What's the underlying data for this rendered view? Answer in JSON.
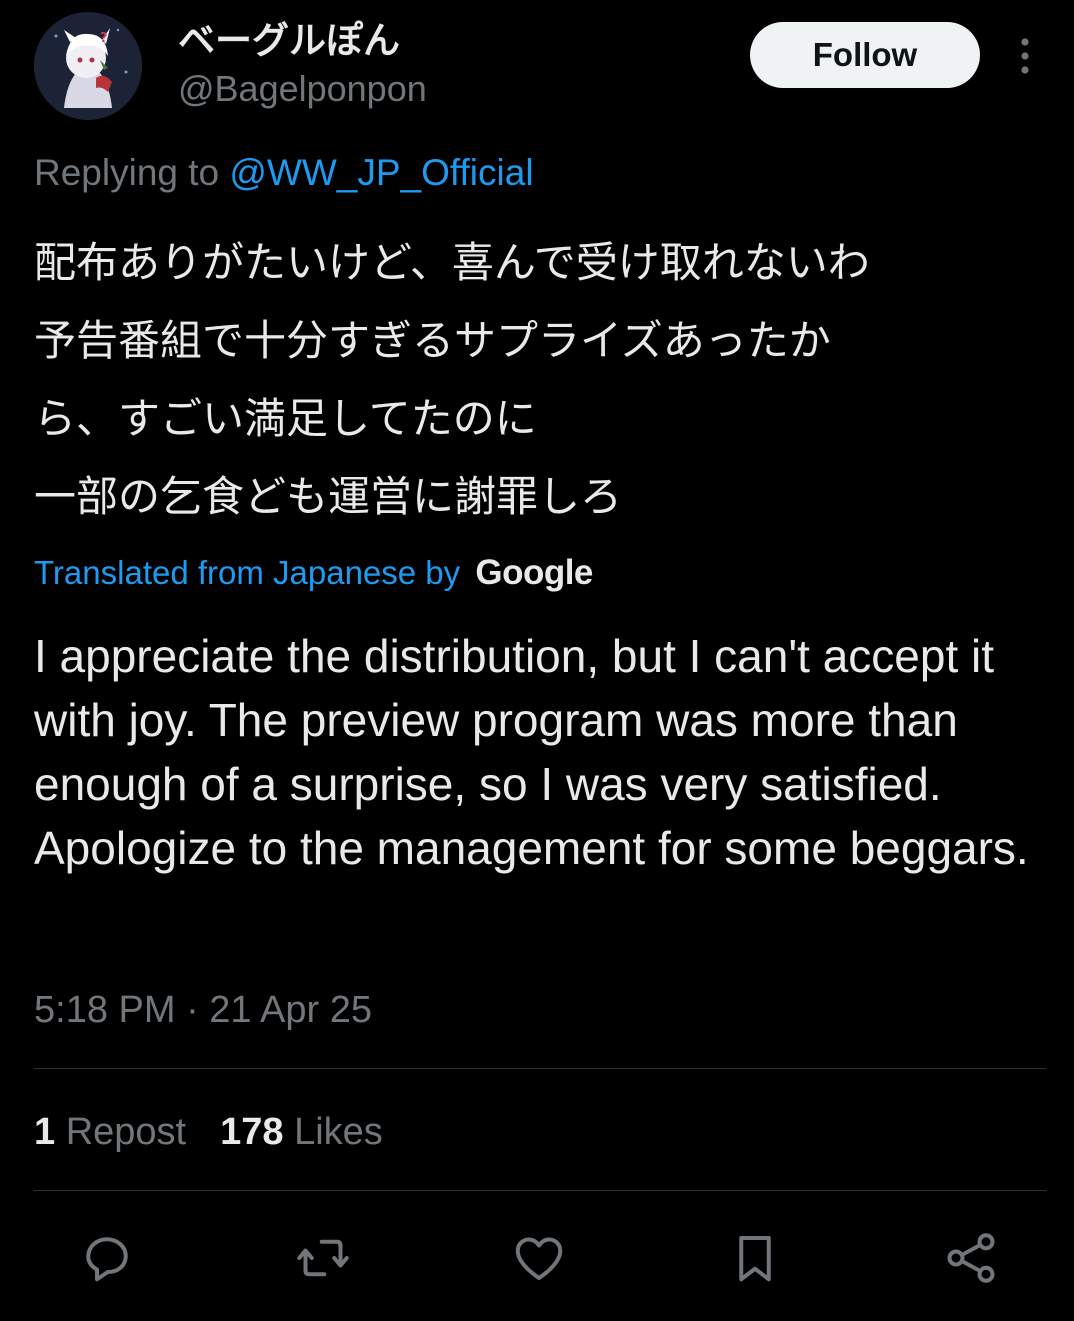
{
  "author": {
    "display_name": "ベーグルぽん",
    "handle": "@Bagelponpon"
  },
  "follow_label": "Follow",
  "reply": {
    "prefix": "Replying to ",
    "mention": "@WW_JP_Official"
  },
  "tweet": {
    "original_text": "配布ありがたいけど、喜んで受け取れないわ\n予告番組で十分すぎるサプライズあったか\nら、すごい満足してたのに\n一部の乞食ども運営に謝罪しろ",
    "translation_label": "Translated from Japanese by",
    "translation_provider": "Google",
    "translated_text": "I appreciate the distribution, but I can't accept it with joy. The preview program was more than enough of a surprise, so I was very satisfied. Apologize to the management for some beggars."
  },
  "timestamp": "5:18 PM · 21 Apr 25",
  "stats": {
    "reposts_count": "1",
    "reposts_label": "Repost",
    "likes_count": "178",
    "likes_label": "Likes"
  },
  "actions": {
    "icons": [
      "reply-icon",
      "repost-icon",
      "like-icon",
      "bookmark-icon",
      "share-icon"
    ]
  },
  "colors": {
    "background": "#000000",
    "text": "#e7e9ea",
    "secondary_text": "#71767b",
    "accent": "#1d9bf0",
    "divider": "#2f3336"
  }
}
